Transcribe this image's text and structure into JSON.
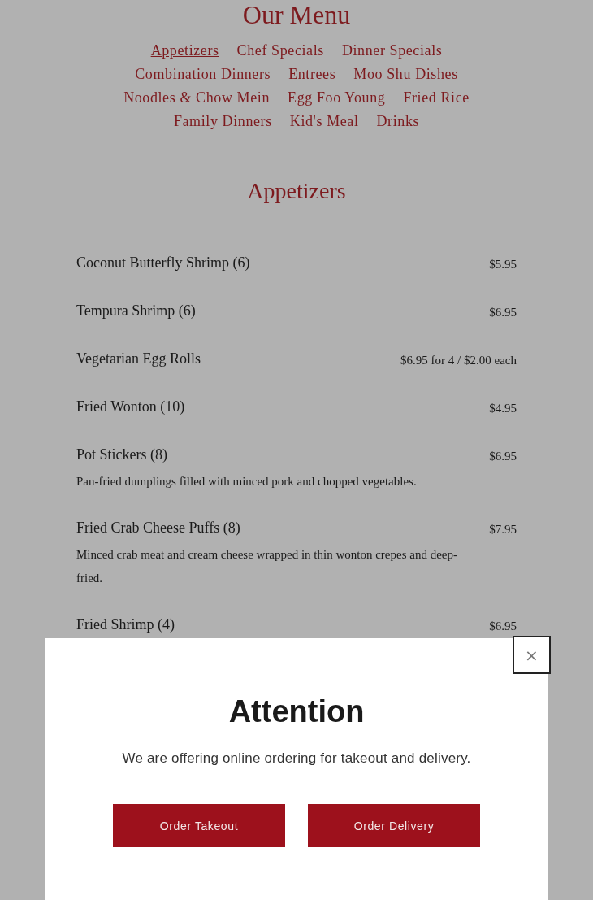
{
  "page_title": "Our Menu",
  "categories": [
    {
      "label": "Appetizers",
      "selected": true
    },
    {
      "label": "Chef Specials",
      "selected": false
    },
    {
      "label": "Dinner Specials",
      "selected": false
    },
    {
      "label": "Combination Dinners",
      "selected": false
    },
    {
      "label": "Entrees",
      "selected": false
    },
    {
      "label": "Moo Shu Dishes",
      "selected": false
    },
    {
      "label": "Noodles & Chow Mein",
      "selected": false
    },
    {
      "label": "Egg Foo Young",
      "selected": false
    },
    {
      "label": "Fried Rice",
      "selected": false
    },
    {
      "label": "Family Dinners",
      "selected": false
    },
    {
      "label": "Kid's Meal",
      "selected": false
    },
    {
      "label": "Drinks",
      "selected": false
    }
  ],
  "section_title": "Appetizers",
  "items": [
    {
      "name": "Coconut Butterfly Shrimp (6)",
      "price": "$5.95"
    },
    {
      "name": "Tempura Shrimp (6)",
      "price": "$6.95"
    },
    {
      "name": "Vegetarian Egg Rolls",
      "price": "$6.95 for 4 / $2.00 each"
    },
    {
      "name": "Fried Wonton (10)",
      "price": "$4.95"
    },
    {
      "name": "Pot Stickers (8)",
      "price": "$6.95",
      "description": "Pan-fried dumplings filled with minced pork and chopped vegetables."
    },
    {
      "name": "Fried Crab Cheese Puffs (8)",
      "price": "$7.95",
      "description": "Minced crab meat and cream cheese wrapped in thin wonton crepes and deep-fried."
    },
    {
      "name": "Fried Shrimp (4)",
      "price": "$6.95"
    }
  ],
  "modal": {
    "close": "×",
    "title": "Attention",
    "message": "We are offering online ordering for takeout and delivery.",
    "buttons": [
      "Order Takeout",
      "Order Delivery"
    ]
  }
}
